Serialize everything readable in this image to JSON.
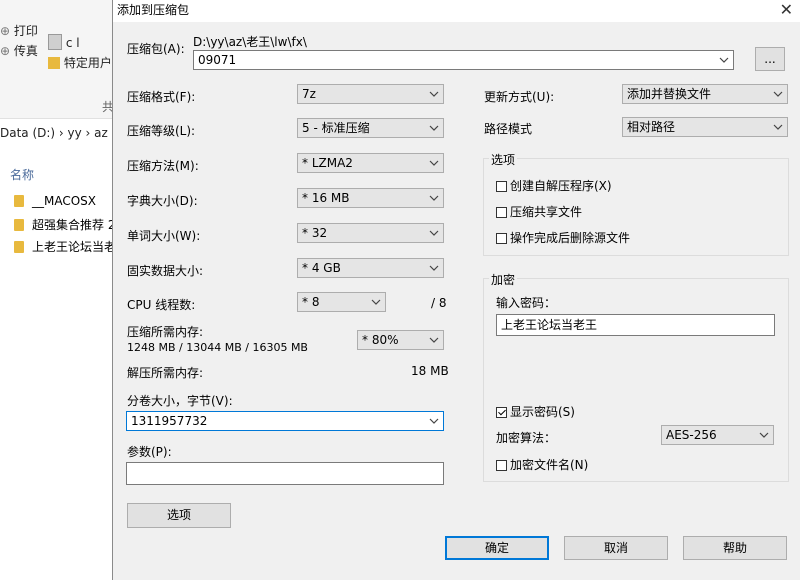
{
  "explorer": {
    "ribbon": {
      "print": "打印",
      "fax": "传真",
      "cl_label": "c l",
      "specific_user": "特定用户",
      "share_group": "共"
    },
    "address": "Data (D:)  ›  yy  ›  az",
    "column_name": "名称",
    "files": [
      "__MACOSX",
      "超强集合推荐 2",
      "上老王论坛当老"
    ]
  },
  "dialog": {
    "title": "添加到压缩包",
    "archive": {
      "label": "压缩包(A):",
      "path": "D:\\yy\\az\\老王\\lw\\fx\\",
      "value": "09071",
      "browse": "..."
    },
    "format": {
      "label": "压缩格式(F):",
      "value": "7z"
    },
    "level": {
      "label": "压缩等级(L):",
      "value": "5 - 标准压缩"
    },
    "method": {
      "label": "压缩方法(M):",
      "value": "* LZMA2"
    },
    "dict": {
      "label": "字典大小(D):",
      "value": "* 16 MB"
    },
    "word": {
      "label": "单词大小(W):",
      "value": "* 32"
    },
    "solid": {
      "label": "固实数据大小:",
      "value": "* 4 GB"
    },
    "threads": {
      "label": "CPU 线程数:",
      "value": "* 8",
      "max": "/ 8"
    },
    "mem_comp": {
      "label": "压缩所需内存:",
      "detail": "1248 MB / 13044 MB / 16305 MB",
      "value": "* 80%"
    },
    "mem_decomp": {
      "label": "解压所需内存:",
      "value": "18 MB"
    },
    "split": {
      "label": "分卷大小，字节(V):",
      "value": "1311957732"
    },
    "params": {
      "label": "参数(P):",
      "value": ""
    },
    "options_button": "选项",
    "update": {
      "label": "更新方式(U):",
      "value": "添加并替换文件"
    },
    "pathmode": {
      "label": "路径模式",
      "value": "相对路径"
    },
    "options_group": {
      "title": "选项",
      "sfx": "创建自解压程序(X)",
      "shared": "压缩共享文件",
      "delete": "操作完成后删除源文件"
    },
    "encryption": {
      "title": "加密",
      "password_label": "输入密码：",
      "password": "上老王论坛当老王",
      "show_password": "显示密码(S)",
      "method_label": "加密算法：",
      "method": "AES-256",
      "encrypt_names": "加密文件名(N)"
    },
    "buttons": {
      "ok": "确定",
      "cancel": "取消",
      "help": "帮助"
    }
  }
}
